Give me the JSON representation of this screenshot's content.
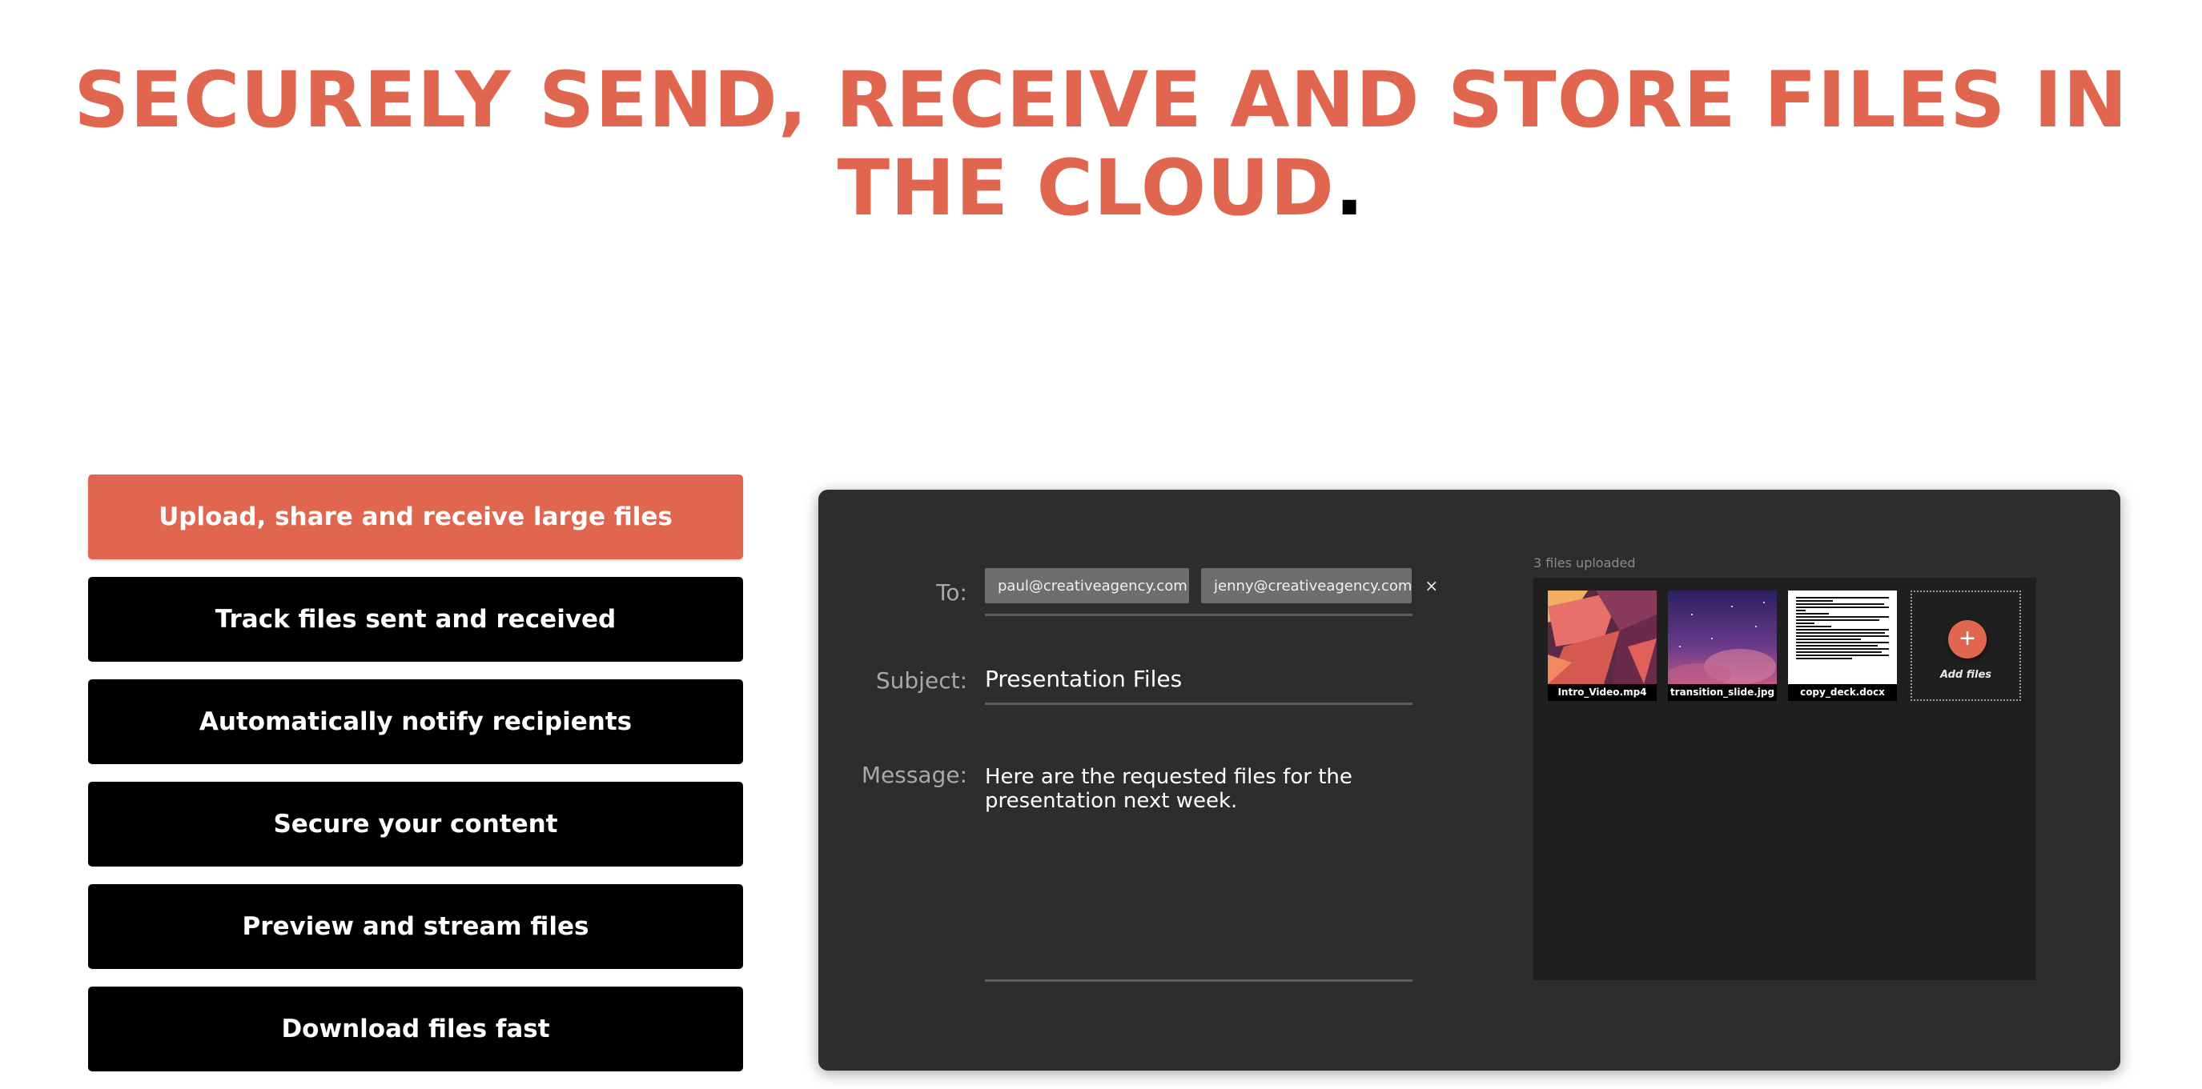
{
  "headline": {
    "line1": "SECURELY SEND, RECEIVE AND STORE FILES IN",
    "line2": "THE CLOUD",
    "period": "."
  },
  "features": [
    {
      "label": "Upload, share and receive large files",
      "active": true
    },
    {
      "label": "Track files sent and received",
      "active": false
    },
    {
      "label": "Automatically notify recipients",
      "active": false
    },
    {
      "label": "Secure your content",
      "active": false
    },
    {
      "label": "Preview and stream files",
      "active": false
    },
    {
      "label": "Download files fast",
      "active": false
    }
  ],
  "compose": {
    "to_label": "To:",
    "recipients": [
      {
        "email": "paul@creativeagency.com",
        "remove_icon": "close-icon"
      },
      {
        "email": "jenny@creativeagency.com",
        "remove_icon": "close-icon"
      }
    ],
    "subject_label": "Subject:",
    "subject_value": "Presentation Files",
    "message_label": "Message:",
    "message_value": "Here are the requested files for the presentation next week."
  },
  "uploads": {
    "count_label": "3 files uploaded",
    "files": [
      {
        "name": "Intro_Video.mp4",
        "type": "video"
      },
      {
        "name": "transition_slide.jpg",
        "type": "image"
      },
      {
        "name": "copy_deck.docx",
        "type": "document"
      }
    ],
    "add_label": "Add files",
    "add_icon": "plus-icon"
  },
  "colors": {
    "accent": "#e06650",
    "panel_bg": "#2d2d2d",
    "upload_bg": "#1f1f1f",
    "chip_bg": "#6e6e6e"
  }
}
